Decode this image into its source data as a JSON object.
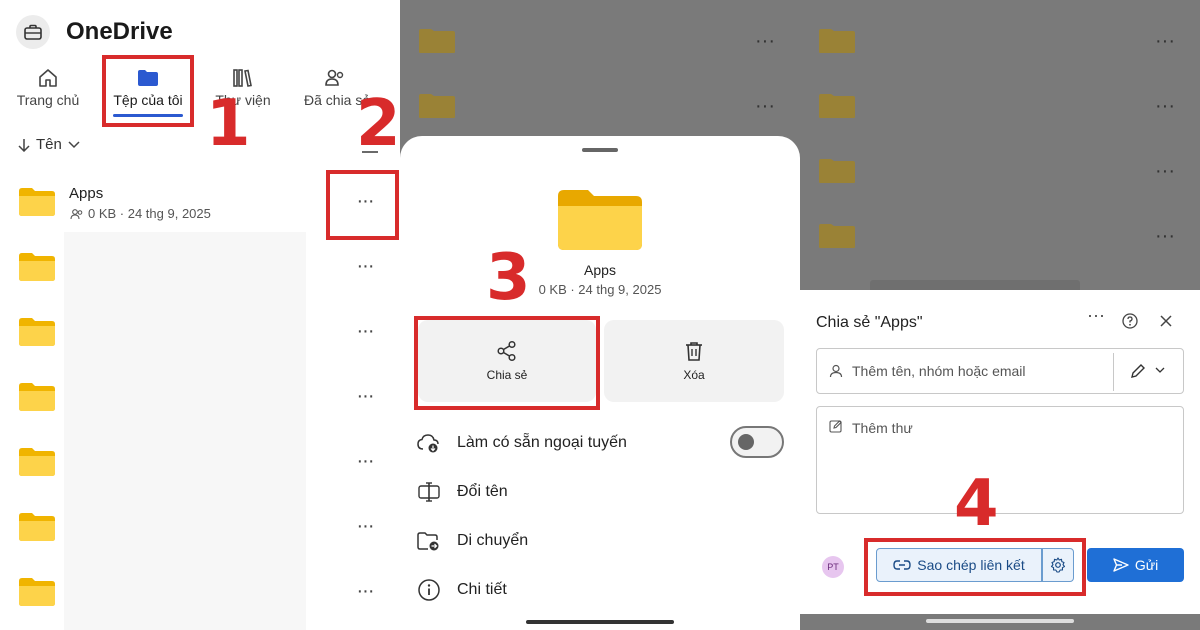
{
  "panel1": {
    "app_title": "OneDrive",
    "nav": {
      "home": "Trang chủ",
      "my_files": "Tệp của tôi",
      "library": "Thư viện",
      "shared": "Đã chia sẻ"
    },
    "sort_label": "Tên",
    "first_file": {
      "name": "Apps",
      "meta": "0 KB · 24 thg 9, 2025"
    },
    "more_glyph": "···"
  },
  "panel2": {
    "folder_name": "Apps",
    "folder_meta": "0 KB · 24 thg 9, 2025",
    "share_label": "Chia sẻ",
    "delete_label": "Xóa",
    "menu": {
      "offline": "Làm có sẵn ngoại tuyến",
      "rename": "Đổi tên",
      "move": "Di chuyển",
      "details": "Chi tiết"
    },
    "offline_toggle_on": false
  },
  "panel3": {
    "dialog_title": "Chia sẻ \"Apps\"",
    "name_placeholder": "Thêm tên, nhóm hoặc email",
    "message_placeholder": "Thêm thư",
    "avatar_initials": "PT",
    "copy_link_label": "Sao chép liên kết",
    "send_label": "Gửi"
  },
  "steps": {
    "s1": "1",
    "s2": "2",
    "s3": "3",
    "s4": "4"
  },
  "colors": {
    "accent": "#2b59d0",
    "highlight": "#d82b2b",
    "folder": "#f5c518",
    "send": "#1f6fd6"
  }
}
